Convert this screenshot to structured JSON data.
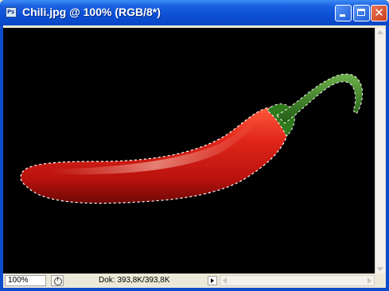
{
  "window": {
    "title": "Chili.jpg @ 100% (RGB/8*)",
    "app_icon": "photoshop-document-icon",
    "controls": {
      "minimize_icon": "minimize-icon",
      "maximize_icon": "maximize-icon",
      "close_icon": "close-icon",
      "close_glyph": "✕"
    }
  },
  "canvas": {
    "background": "#000000",
    "image_subject": "red-chili-pepper",
    "selection": "marching-ants-outline"
  },
  "statusbar": {
    "zoom": "100%",
    "doc_info": "Dok: 393,8K/393,8K",
    "info_icon": "status-info-icon",
    "menu_arrow_icon": "play-arrow-icon"
  },
  "colors": {
    "titlebar": "#0c4fd6",
    "pepper_red": "#d01810",
    "stem_green": "#2f7a1c"
  }
}
